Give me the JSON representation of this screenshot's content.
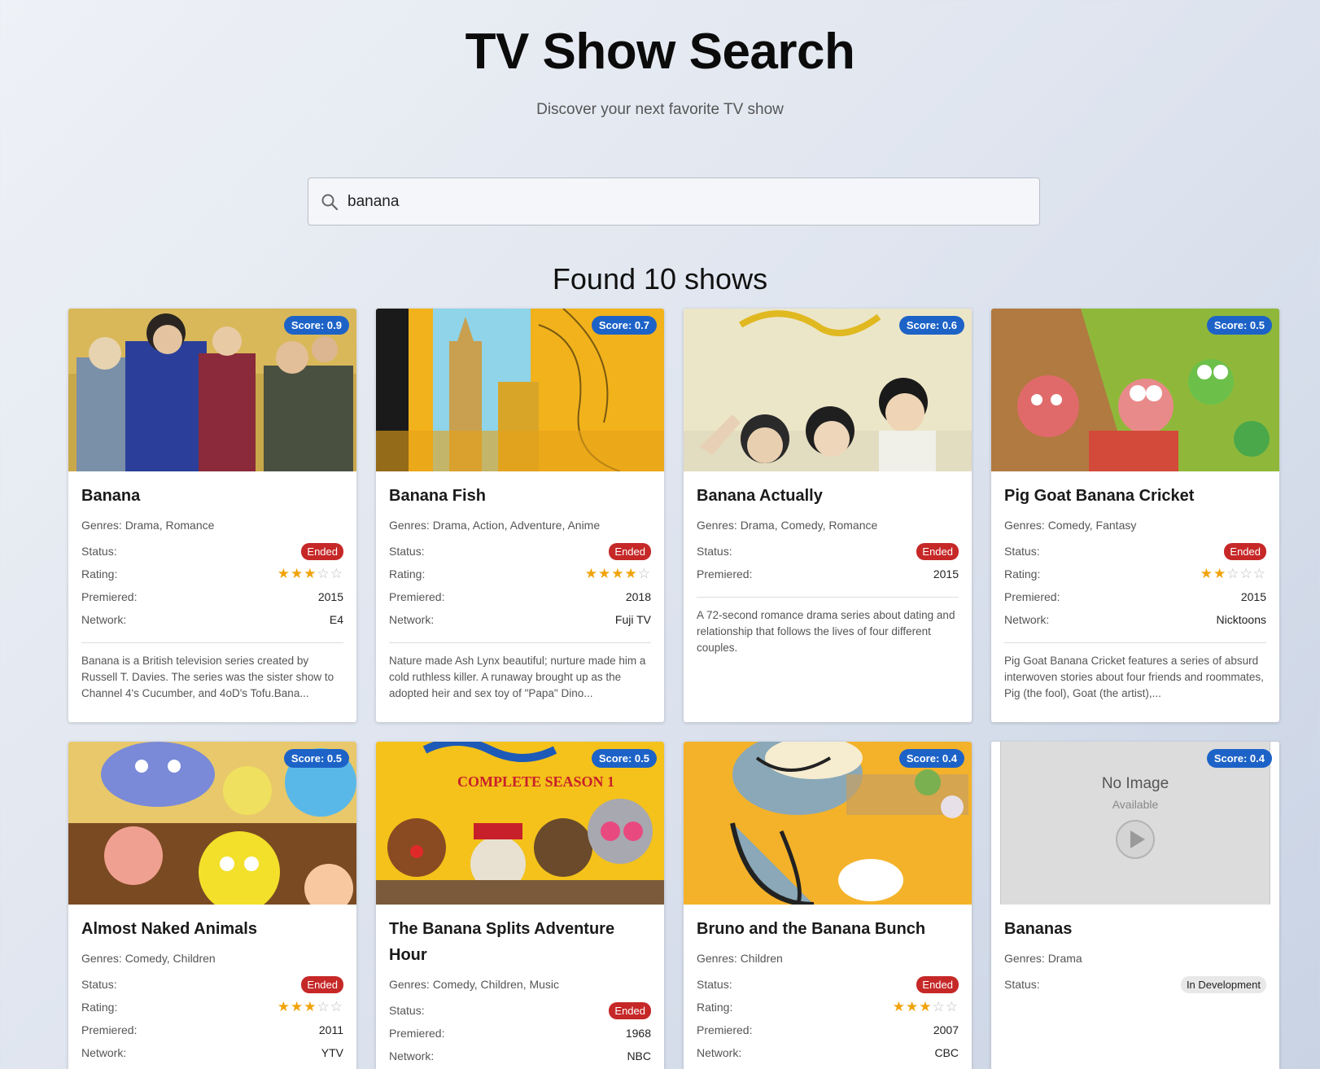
{
  "header": {
    "title": "TV Show Search",
    "subtitle": "Discover your next favorite TV show"
  },
  "search": {
    "value": "banana",
    "icon": "search-icon"
  },
  "results": {
    "count_text": "Found 10 shows"
  },
  "labels": {
    "status": "Status:",
    "rating": "Rating:",
    "premiered": "Premiered:",
    "network": "Network:"
  },
  "colors": {
    "score_badge": "#1d63c7",
    "status_ended": "#c62828",
    "star": "#f0a30a"
  },
  "shows": [
    {
      "title": "Banana",
      "score": "Score: 0.9",
      "genres": "Genres: Drama, Romance",
      "status": "Ended",
      "rating_stars": 3,
      "premiered": "2015",
      "network": "E4",
      "description": "Banana is a British television series created by Russell T. Davies. The series was the sister show to Channel 4's Cucumber, and 4oD's Tofu.Bana..."
    },
    {
      "title": "Banana Fish",
      "score": "Score: 0.7",
      "genres": "Genres: Drama, Action, Adventure, Anime",
      "status": "Ended",
      "rating_stars": 4,
      "premiered": "2018",
      "network": "Fuji TV",
      "description": "Nature made Ash Lynx beautiful; nurture made him a cold ruthless killer. A runaway brought up as the adopted heir and sex toy of \"Papa\" Dino..."
    },
    {
      "title": "Banana Actually",
      "score": "Score: 0.6",
      "genres": "Genres: Drama, Comedy, Romance",
      "status": "Ended",
      "premiered": "2015",
      "description": "A 72-second romance drama series about dating and relationship that follows the lives of four different couples."
    },
    {
      "title": "Pig Goat Banana Cricket",
      "score": "Score: 0.5",
      "genres": "Genres: Comedy, Fantasy",
      "status": "Ended",
      "rating_stars": 2,
      "premiered": "2015",
      "network": "Nicktoons",
      "description": "Pig Goat Banana Cricket features a series of absurd interwoven stories about four friends and roommates, Pig (the fool), Goat (the artist),..."
    },
    {
      "title": "Almost Naked Animals",
      "score": "Score: 0.5",
      "genres": "Genres: Comedy, Children",
      "status": "Ended",
      "rating_stars": 3,
      "premiered": "2011",
      "network": "YTV"
    },
    {
      "title": "The Banana Splits Adventure Hour",
      "score": "Score: 0.5",
      "genres": "Genres: Comedy, Children, Music",
      "status": "Ended",
      "premiered": "1968",
      "network": "NBC"
    },
    {
      "title": "Bruno and the Banana Bunch",
      "score": "Score: 0.4",
      "genres": "Genres: Children",
      "status": "Ended",
      "rating_stars": 3,
      "premiered": "2007",
      "network": "CBC"
    },
    {
      "title": "Bananas",
      "score": "Score: 0.4",
      "genres": "Genres: Drama",
      "status": "In Development",
      "no_image_title": "No Image",
      "no_image_sub": "Available"
    }
  ]
}
